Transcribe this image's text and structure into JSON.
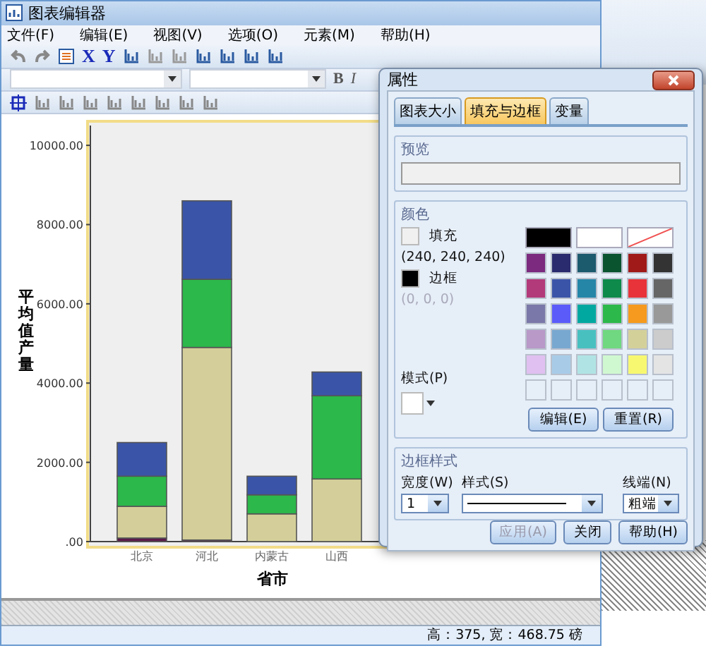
{
  "window": {
    "title": "图表编辑器"
  },
  "menu": [
    "文件(F)",
    "编辑(E)",
    "视图(V)",
    "选项(O)",
    "元素(M)",
    "帮助(H)"
  ],
  "toolbar": {
    "letters": [
      "X",
      "Y"
    ]
  },
  "format_bar": {
    "bold": "B",
    "italic": "I"
  },
  "chart_data": {
    "type": "bar",
    "stacked": true,
    "xlabel": "省市",
    "ylabel": "平均值产量",
    "categories": [
      "北京",
      "河北",
      "内蒙古",
      "山西"
    ],
    "ylim": [
      0,
      10500
    ],
    "yticks": [
      {
        "value": 0,
        "label": ".00"
      },
      {
        "value": 2000,
        "label": "2000.00"
      },
      {
        "value": 4000,
        "label": "4000.00"
      },
      {
        "value": 6000,
        "label": "6000.00"
      },
      {
        "value": 8000,
        "label": "8000.00"
      },
      {
        "value": 10000,
        "label": "10000.00"
      }
    ],
    "series": [
      {
        "color": "#5a1a4a",
        "values": [
          90,
          40,
          0,
          0
        ]
      },
      {
        "color": "#d4cf9a",
        "values": [
          800,
          4860,
          700,
          1580
        ]
      },
      {
        "color": "#2cb84a",
        "values": [
          760,
          1720,
          480,
          2100
        ]
      },
      {
        "color": "#3a55a8",
        "values": [
          850,
          1980,
          470,
          600
        ]
      }
    ]
  },
  "status_bar": "高：375, 宽：468.75 磅",
  "dialog": {
    "title": "属性",
    "tabs": [
      {
        "label": "图表大小",
        "selected": false
      },
      {
        "label": "填充与边框",
        "selected": true
      },
      {
        "label": "变量",
        "selected": false
      }
    ],
    "preview": {
      "title": "预览"
    },
    "color": {
      "title": "颜色",
      "fill": {
        "label": "填充",
        "value": "(240, 240, 240)",
        "color": "#f0f0f0",
        "disabled": false
      },
      "border": {
        "label": "边框",
        "value": "(0, 0, 0)",
        "color": "#000000",
        "disabled": true
      },
      "pattern_label": "模式(P)",
      "palette_top": [
        {
          "color": "#000000",
          "kind": "swatch"
        },
        {
          "color": "#ffffff",
          "kind": "swatch"
        },
        {
          "kind": "none"
        }
      ],
      "palette": [
        {
          "kind": "swatch",
          "color": "#7b2a7f"
        },
        {
          "kind": "swatch",
          "color": "#2a2a6e"
        },
        {
          "kind": "swatch",
          "color": "#1c5a6e"
        },
        {
          "kind": "swatch",
          "color": "#0a5430"
        },
        {
          "kind": "swatch",
          "color": "#a01a1a"
        },
        {
          "kind": "swatch",
          "color": "#333333"
        },
        {
          "kind": "swatch",
          "color": "#b33a7a"
        },
        {
          "kind": "swatch",
          "color": "#3a55a8"
        },
        {
          "kind": "swatch",
          "color": "#2586a8"
        },
        {
          "kind": "swatch",
          "color": "#0e8a4a"
        },
        {
          "kind": "swatch",
          "color": "#e8333a"
        },
        {
          "kind": "swatch",
          "color": "#666666"
        },
        {
          "kind": "swatch",
          "color": "#7a78a8"
        },
        {
          "kind": "swatch",
          "color": "#5b5bfa"
        },
        {
          "kind": "swatch",
          "color": "#00a8a0"
        },
        {
          "kind": "swatch",
          "color": "#2cb84a"
        },
        {
          "kind": "swatch",
          "color": "#f59a1e"
        },
        {
          "kind": "swatch",
          "color": "#999999"
        },
        {
          "kind": "swatch",
          "color": "#b899c8"
        },
        {
          "kind": "swatch",
          "color": "#78a8d0"
        },
        {
          "kind": "swatch",
          "color": "#48c0c0"
        },
        {
          "kind": "swatch",
          "color": "#70d880"
        },
        {
          "kind": "swatch",
          "color": "#d4d09a"
        },
        {
          "kind": "swatch",
          "color": "#cccccc"
        },
        {
          "kind": "swatch",
          "color": "#e0c0f0"
        },
        {
          "kind": "swatch",
          "color": "#a8cce8"
        },
        {
          "kind": "swatch",
          "color": "#b0e4e4"
        },
        {
          "kind": "swatch",
          "color": "#d0f8d0"
        },
        {
          "kind": "swatch",
          "color": "#f8f870"
        },
        {
          "kind": "swatch",
          "color": "#e4e4e4"
        },
        {
          "kind": "empty"
        },
        {
          "kind": "empty"
        },
        {
          "kind": "empty"
        },
        {
          "kind": "empty"
        },
        {
          "kind": "empty"
        },
        {
          "kind": "empty"
        }
      ],
      "buttons": [
        "编辑(E)",
        "重置(R)"
      ]
    },
    "border_style": {
      "title": "边框样式",
      "width_label": "宽度(W)",
      "width_value": "1",
      "style_label": "样式(S)",
      "end_label": "线端(N)",
      "end_value": "粗端"
    },
    "buttons": [
      {
        "label": "应用(A)",
        "disabled": true
      },
      {
        "label": "关闭",
        "disabled": false
      },
      {
        "label": "帮助(H)",
        "disabled": false
      }
    ]
  }
}
